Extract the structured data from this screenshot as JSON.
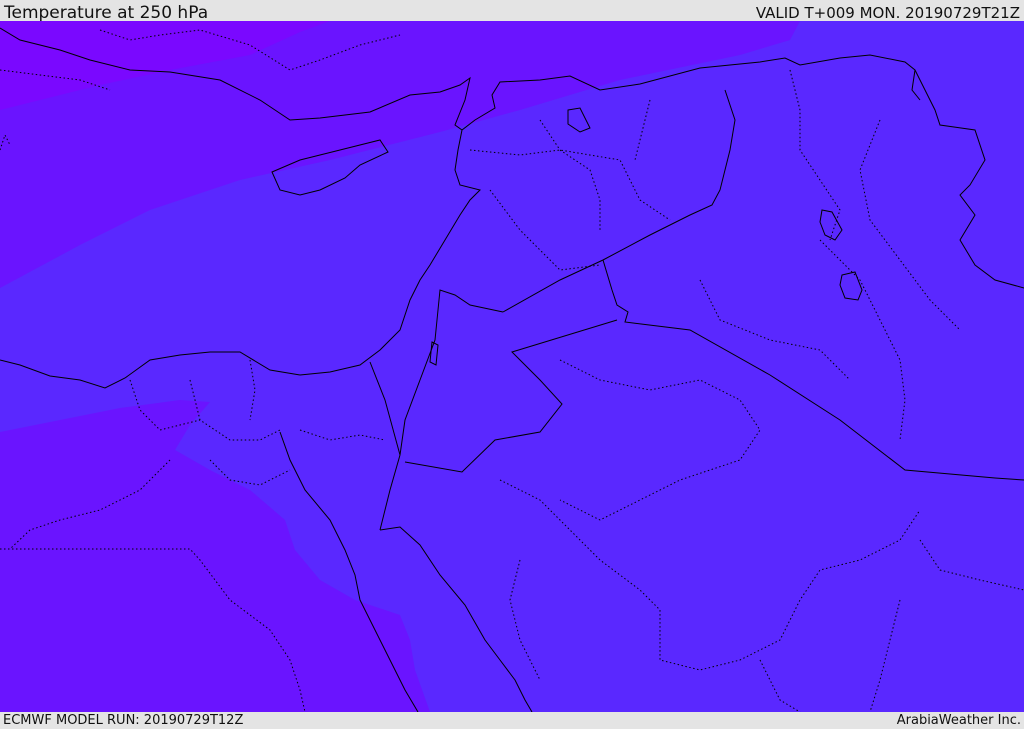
{
  "header": {
    "title": "Temperature at 250 hPa",
    "valid": "VALID T+009 MON. 20190729T21Z"
  },
  "footer": {
    "model_run": "ECMWF MODEL RUN: 20190729T12Z",
    "credit": "ArabiaWeather Inc."
  },
  "map": {
    "region": "Eastern Mediterranean / Levant / Iraq / Northern Saudi Arabia / Egypt",
    "variable": "Temperature",
    "level": "250 hPa",
    "colors": {
      "base_band": "#5a28ff",
      "mid_band": "#6a14ff",
      "cold_band": "#7a08ff",
      "border": "#000000",
      "header_background": "#e4e4e4"
    }
  }
}
